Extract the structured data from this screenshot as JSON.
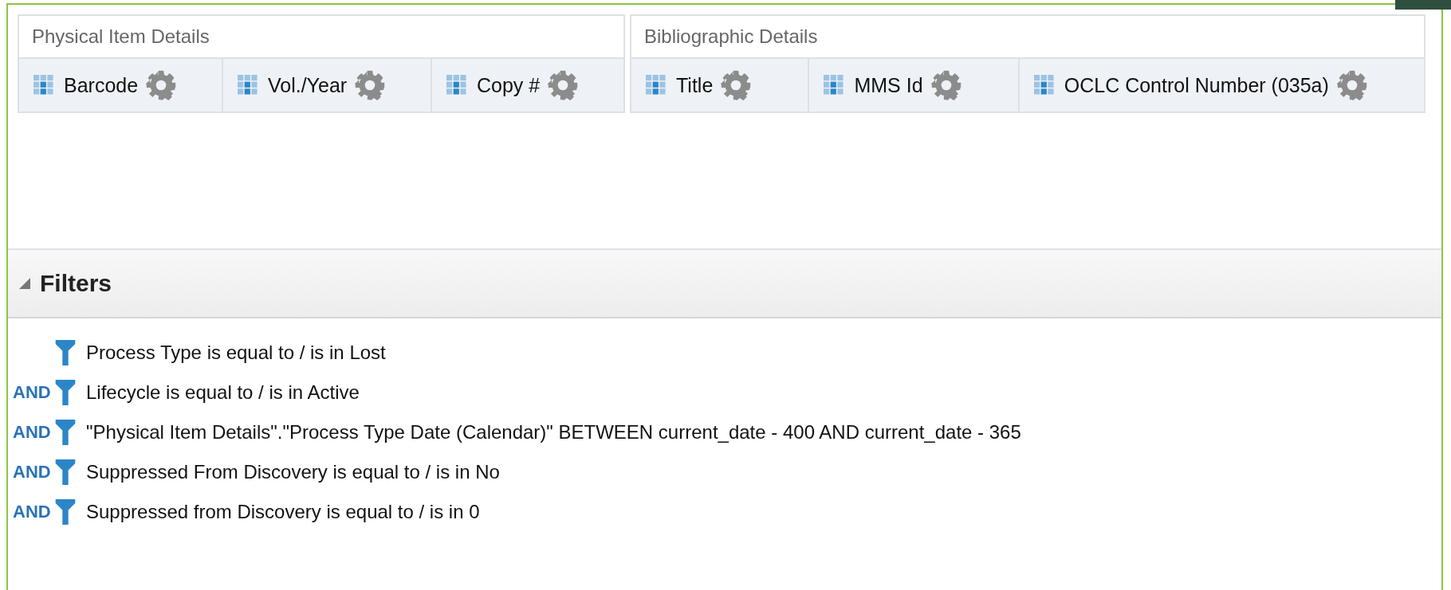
{
  "column_groups": [
    {
      "title": "Physical Item Details",
      "columns": [
        "Barcode",
        "Vol./Year",
        "Copy #"
      ]
    },
    {
      "title": "Bibliographic Details",
      "columns": [
        "Title",
        "MMS Id",
        "OCLC Control Number (035a)"
      ]
    }
  ],
  "filters": {
    "title": "Filters",
    "expanded": true,
    "items": [
      {
        "text": "Process Type is equal to / is in  Lost"
      },
      {
        "conjunction": "AND",
        "text": "Lifecycle is equal to / is in  Active"
      },
      {
        "conjunction": "AND",
        "text": "\"Physical Item Details\".\"Process Type Date (Calendar)\" BETWEEN current_date - 400 AND current_date - 365"
      },
      {
        "conjunction": "AND",
        "text": "Suppressed From Discovery is equal to / is in  No"
      },
      {
        "conjunction": "AND",
        "text": "Suppressed from Discovery is equal to / is in  0"
      }
    ]
  }
}
